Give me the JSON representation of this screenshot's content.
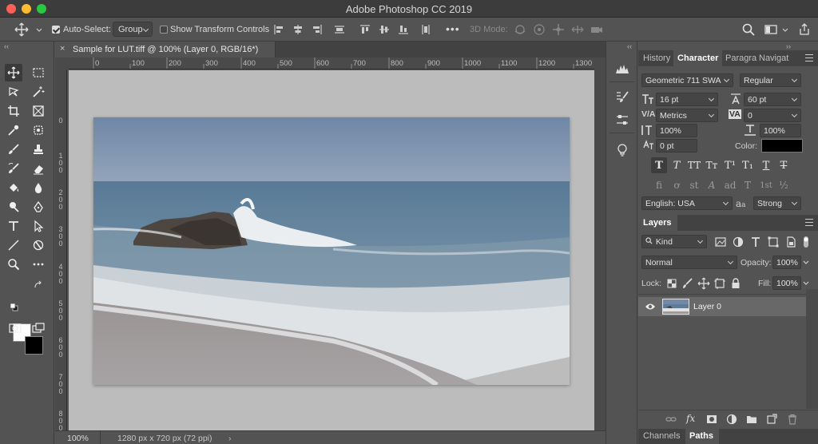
{
  "window": {
    "title": "Adobe Photoshop CC 2019"
  },
  "options_bar": {
    "auto_select_label": "Auto-Select:",
    "auto_select_checked": true,
    "auto_select_target": "Group",
    "show_transform_label": "Show Transform Controls",
    "show_transform_checked": false,
    "more_label": "•••",
    "mode_3d_label": "3D Mode:"
  },
  "document": {
    "tab_close": "×",
    "tab_title": "Sample for LUT.tiff @ 100% (Layer 0, RGB/16*)",
    "ruler_h": [
      "0",
      "100",
      "200",
      "300",
      "400",
      "500",
      "600",
      "700",
      "800",
      "900",
      "1000",
      "1100",
      "1200",
      "1300"
    ],
    "ruler_v": [
      "0",
      "1 0 0",
      "2 0 0",
      "3 0 0",
      "4 0 0",
      "5 0 0",
      "6 0 0",
      "7 0 0",
      "8 0 0"
    ]
  },
  "status": {
    "zoom": "100%",
    "info": "1280 px x 720 px (72 ppi)",
    "arrow": "›"
  },
  "character_panel": {
    "tabs": [
      "History",
      "Character",
      "Paragra",
      "Navigat"
    ],
    "active_tab": "Character",
    "font_family": "Geometric 711 SWA",
    "font_style": "Regular",
    "font_size": "16 pt",
    "leading": "60 pt",
    "kerning": "Metrics",
    "tracking": "0",
    "vertical_scale": "100%",
    "horizontal_scale": "100%",
    "baseline_shift": "0 pt",
    "color_label": "Color:",
    "color_value": "#000000",
    "type_buttons": [
      "T",
      "T",
      "TT",
      "Tт",
      "T¹",
      "T₁",
      "T",
      "T"
    ],
    "opentype_buttons": [
      "fi",
      "ơ",
      "st",
      "A",
      "ad",
      "T",
      "1st",
      "½"
    ],
    "language": "English: USA",
    "aa_label": "a",
    "antialias": "Strong"
  },
  "layers_panel": {
    "tab": "Layers",
    "filter_kind": "Kind",
    "blend_mode": "Normal",
    "opacity_label": "Opacity:",
    "opacity": "100%",
    "lock_label": "Lock:",
    "fill_label": "Fill:",
    "fill": "100%",
    "layers": [
      {
        "name": "Layer 0",
        "visible": true
      }
    ],
    "footer_icons": [
      "link-icon",
      "fx-icon",
      "mask-icon",
      "adjustment-icon",
      "folder-icon",
      "new-layer-icon",
      "trash-icon"
    ],
    "fx_label": "fx"
  },
  "bottom_tabs": {
    "tabs": [
      "Channels",
      "Paths"
    ],
    "active": "Paths"
  },
  "colors": {
    "foreground": "#ffffff",
    "background": "#000000",
    "ui_dark": "#535353",
    "canvas_bg": "#bcbcbc"
  }
}
